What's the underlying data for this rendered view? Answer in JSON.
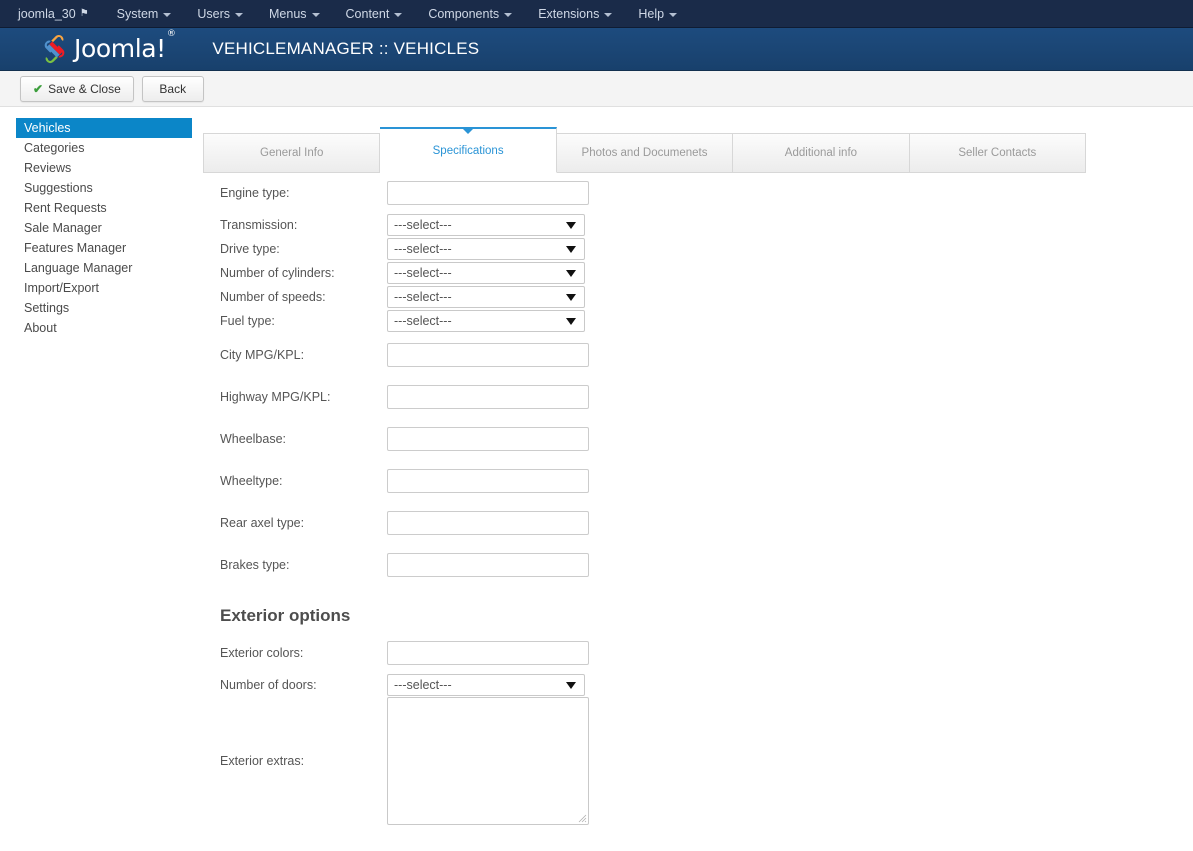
{
  "adminbar": {
    "brand": "joomla_30",
    "brand_icon": "external-link-icon",
    "items": [
      {
        "label": "System"
      },
      {
        "label": "Users"
      },
      {
        "label": "Menus"
      },
      {
        "label": "Content"
      },
      {
        "label": "Components"
      },
      {
        "label": "Extensions"
      },
      {
        "label": "Help"
      }
    ]
  },
  "header": {
    "logo_text": "Joomla!",
    "logo_sup": "®",
    "page_title": "VEHICLEMANAGER :: VEHICLES",
    "gradient_top": "#1d4b7e",
    "gradient_bottom": "#18406c"
  },
  "toolbar": {
    "save_close_label": "Save & Close",
    "save_close_icon": "checkmark-icon",
    "back_label": "Back"
  },
  "sidebar": {
    "active_color": "#0b86c8",
    "items": [
      {
        "label": "Vehicles",
        "active": true
      },
      {
        "label": "Categories",
        "active": false
      },
      {
        "label": "Reviews",
        "active": false
      },
      {
        "label": "Suggestions",
        "active": false
      },
      {
        "label": "Rent Requests",
        "active": false
      },
      {
        "label": "Sale Manager",
        "active": false
      },
      {
        "label": "Features Manager",
        "active": false
      },
      {
        "label": "Language Manager",
        "active": false
      },
      {
        "label": "Import/Export",
        "active": false
      },
      {
        "label": "Settings",
        "active": false
      },
      {
        "label": "About",
        "active": false
      }
    ]
  },
  "tabs": {
    "active_color": "#2a94d6",
    "items": [
      {
        "label": "General Info",
        "active": false
      },
      {
        "label": "Specifications",
        "active": true
      },
      {
        "label": "Photos and Documenets",
        "active": false
      },
      {
        "label": "Additional info",
        "active": false
      },
      {
        "label": "Seller Contacts",
        "active": false
      }
    ]
  },
  "form": {
    "select_placeholder": "---select---",
    "fields": [
      {
        "label": "Engine type:",
        "type": "text",
        "value": ""
      },
      {
        "label": "Transmission:",
        "type": "select",
        "value": "---select---"
      },
      {
        "label": "Drive type:",
        "type": "select",
        "value": "---select---"
      },
      {
        "label": "Number of cylinders:",
        "type": "select",
        "value": "---select---"
      },
      {
        "label": "Number of speeds:",
        "type": "select",
        "value": "---select---"
      },
      {
        "label": "Fuel type:",
        "type": "select",
        "value": "---select---"
      },
      {
        "label": "City MPG/KPL:",
        "type": "text",
        "value": ""
      },
      {
        "label": "Highway MPG/KPL:",
        "type": "text",
        "value": ""
      },
      {
        "label": "Wheelbase:",
        "type": "text",
        "value": ""
      },
      {
        "label": "Wheeltype:",
        "type": "text",
        "value": ""
      },
      {
        "label": "Rear axel type:",
        "type": "text",
        "value": ""
      },
      {
        "label": "Brakes type:",
        "type": "text",
        "value": ""
      }
    ],
    "exterior": {
      "heading": "Exterior options",
      "fields": [
        {
          "label": "Exterior colors:",
          "type": "text",
          "value": ""
        },
        {
          "label": "Number of doors:",
          "type": "select",
          "value": "---select---"
        },
        {
          "label": "Exterior extras:",
          "type": "textarea",
          "value": ""
        }
      ]
    }
  }
}
